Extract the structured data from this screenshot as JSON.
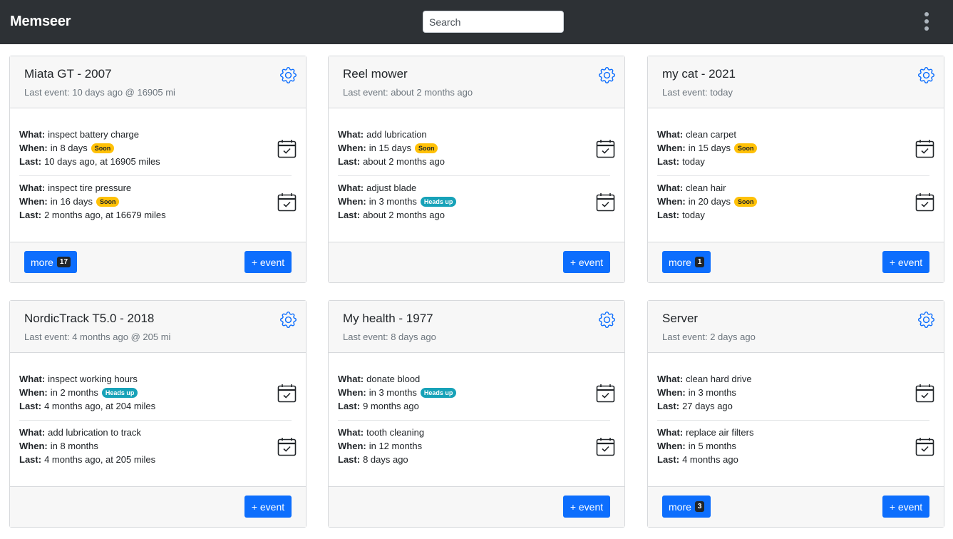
{
  "app": {
    "title": "Memseer"
  },
  "search": {
    "placeholder": "Search"
  },
  "labels": {
    "what": "What:",
    "when": "When:",
    "last": "Last:",
    "add_event": "+ event",
    "more": "more"
  },
  "cards": [
    {
      "title": "Miata GT - 2007",
      "subtitle": "Last event: 10 days ago @ 16905 mi",
      "more_count": "17",
      "tasks": [
        {
          "what": "inspect battery charge",
          "when": "in 8 days",
          "badge": "Soon",
          "last": "10 days ago, at 16905 miles"
        },
        {
          "what": "inspect tire pressure",
          "when": "in 16 days",
          "badge": "Soon",
          "last": "2 months ago, at 16679 miles"
        }
      ]
    },
    {
      "title": "Reel mower",
      "subtitle": "Last event: about 2 months ago",
      "more_count": "",
      "tasks": [
        {
          "what": "add lubrication",
          "when": "in 15 days",
          "badge": "Soon",
          "last": "about 2 months ago"
        },
        {
          "what": "adjust blade",
          "when": "in 3 months",
          "badge": "Heads up",
          "last": "about 2 months ago"
        }
      ]
    },
    {
      "title": "my cat - 2021",
      "subtitle": "Last event: today",
      "more_count": "1",
      "tasks": [
        {
          "what": "clean carpet",
          "when": "in 15 days",
          "badge": "Soon",
          "last": "today"
        },
        {
          "what": "clean hair",
          "when": "in 20 days",
          "badge": "Soon",
          "last": "today"
        }
      ]
    },
    {
      "title": "NordicTrack T5.0 - 2018",
      "subtitle": "Last event: 4 months ago @ 205 mi",
      "more_count": "",
      "tasks": [
        {
          "what": "inspect working hours",
          "when": "in 2 months",
          "badge": "Heads up",
          "last": "4 months ago, at 204 miles"
        },
        {
          "what": "add lubrication to track",
          "when": "in 8 months",
          "badge": "",
          "last": "4 months ago, at 205 miles"
        }
      ]
    },
    {
      "title": "My health - 1977",
      "subtitle": "Last event: 8 days ago",
      "more_count": "",
      "tasks": [
        {
          "what": "donate blood",
          "when": "in 3 months",
          "badge": "Heads up",
          "last": "9 months ago"
        },
        {
          "what": "tooth cleaning",
          "when": "in 12 months",
          "badge": "",
          "last": "8 days ago"
        }
      ]
    },
    {
      "title": "Server",
      "subtitle": "Last event: 2 days ago",
      "more_count": "3",
      "tasks": [
        {
          "what": "clean hard drive",
          "when": "in 3 months",
          "badge": "",
          "last": "27 days ago"
        },
        {
          "what": "replace air filters",
          "when": "in 5 months",
          "badge": "",
          "last": "4 months ago"
        }
      ]
    }
  ],
  "colors": {
    "navbar": "#2d3135",
    "primary": "#0d6efd",
    "soon_badge": "#ffc107",
    "heads_up_badge": "#17a2b8",
    "gear_icon": "#0d6efd"
  }
}
